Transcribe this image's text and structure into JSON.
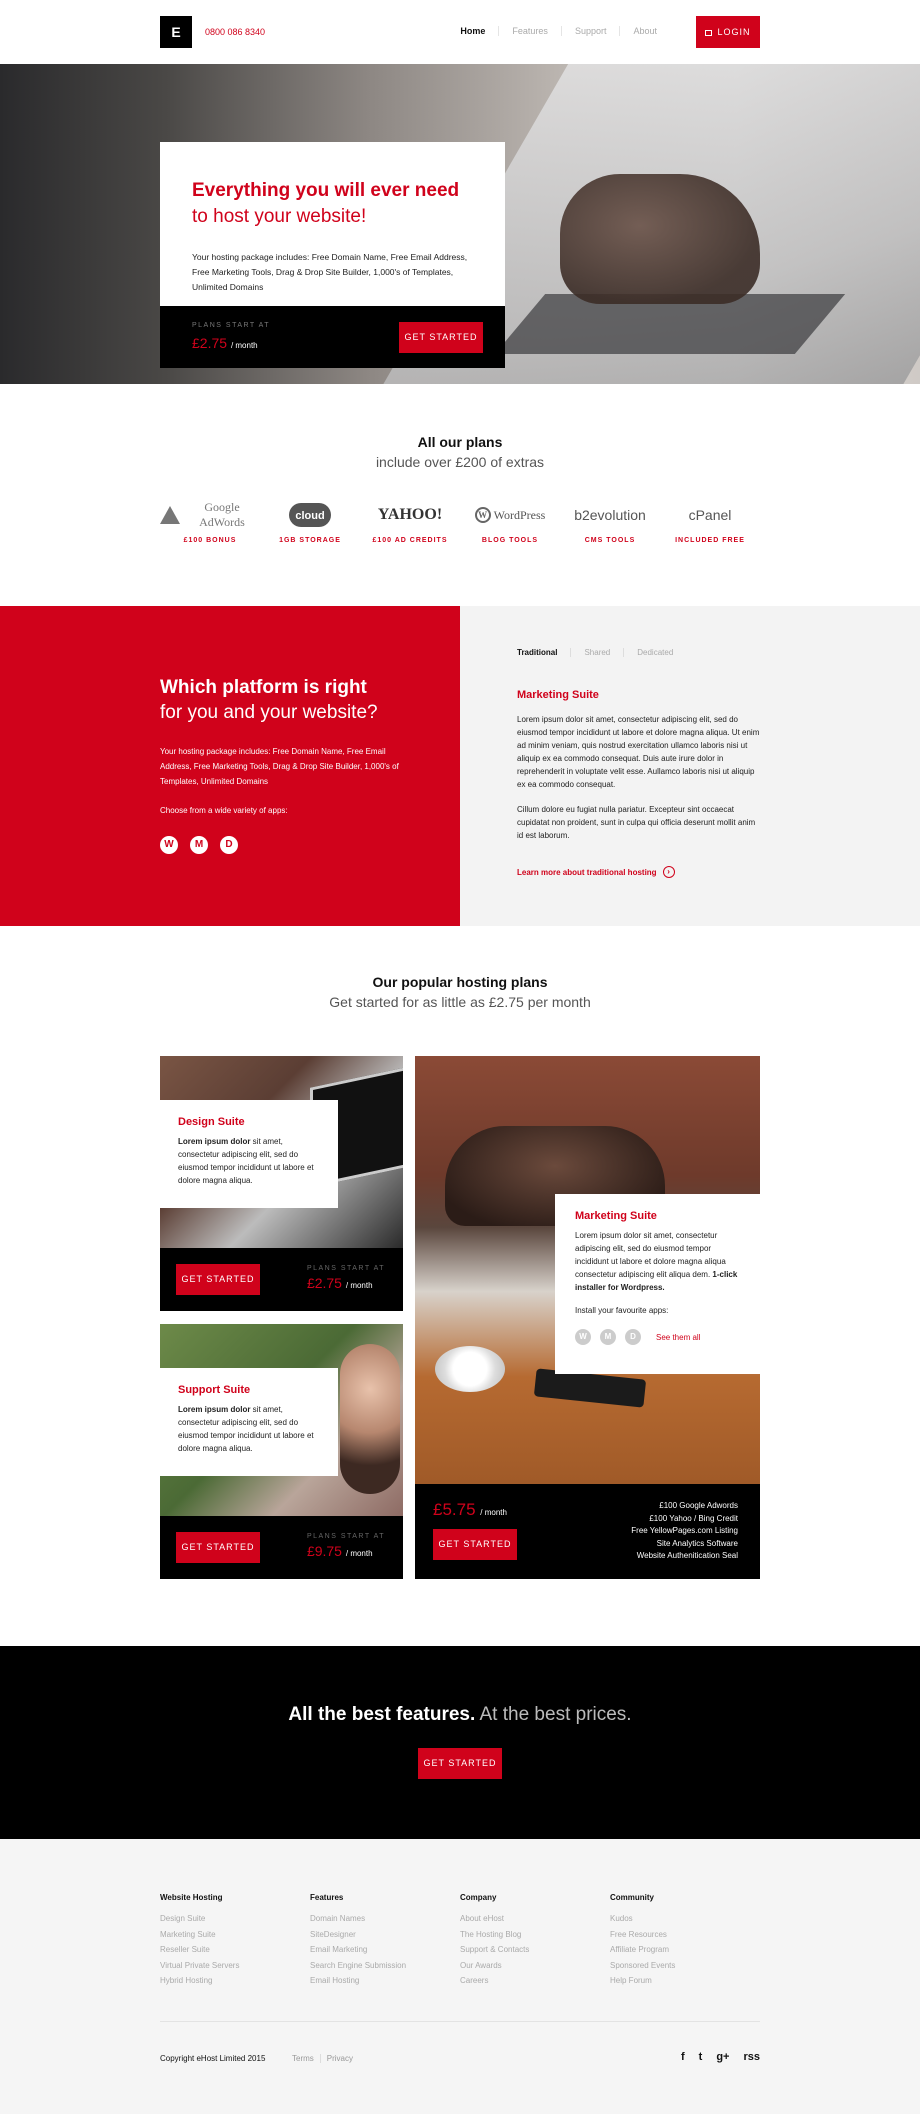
{
  "header": {
    "logo": "E",
    "phone": "0800 086 8340",
    "nav": [
      "Home",
      "Features",
      "Support",
      "About"
    ],
    "login": "LOGIN"
  },
  "hero": {
    "title": "Everything you will ever need",
    "subtitle": "to host your website!",
    "body": "Your hosting package includes: Free Domain Name, Free Email Address, Free Marketing Tools, Drag & Drop Site Builder, 1,000's of Templates, Unlimited Domains",
    "plans_label": "PLANS START AT",
    "price": "£2.75",
    "price_unit": "/ month",
    "cta": "GET STARTED"
  },
  "plans": {
    "title": "All our plans",
    "subtitle": "include over £200 of extras",
    "brands": [
      {
        "logo": "Google AdWords",
        "caption": "£100 BONUS"
      },
      {
        "logo": "cloud",
        "caption": "1GB STORAGE"
      },
      {
        "logo": "YAHOO!",
        "caption": "£100 AD CREDITS"
      },
      {
        "logo": "WordPress",
        "caption": "BLOG TOOLS"
      },
      {
        "logo": "b2evolution",
        "caption": "CMS TOOLS"
      },
      {
        "logo": "cPanel",
        "caption": "INCLUDED FREE"
      }
    ]
  },
  "platform": {
    "title": "Which platform is right",
    "subtitle": "for you and your website?",
    "body": "Your hosting package includes: Free Domain Name, Free Email Address, Free Marketing Tools, Drag & Drop Site Builder, 1,000's of Templates, Unlimited Domains",
    "choose": "Choose from a wide variety of apps:",
    "tabs": [
      "Traditional",
      "Shared",
      "Dedicated"
    ],
    "panel_title": "Marketing Suite",
    "panel_p1": "Lorem ipsum dolor sit amet, consectetur adipiscing elit, sed do eiusmod tempor incididunt ut labore et dolore magna aliqua. Ut enim ad minim veniam, quis nostrud exercitation ullamco laboris nisi ut aliquip ex ea commodo consequat. Duis aute irure dolor in reprehenderit in voluptate velit esse. Aullamco laboris nisi ut aliquip ex ea commodo consequat.",
    "panel_p2": "Cillum dolore eu fugiat nulla pariatur. Excepteur sint occaecat cupidatat non proident, sunt in culpa qui officia deserunt mollit anim id est laborum.",
    "learn_more": "Learn more about traditional hosting"
  },
  "popular": {
    "title": "Our popular hosting plans",
    "subtitle": "Get started for as little as £2.75 per month",
    "design": {
      "title": "Design Suite",
      "lead": "Lorem ipsum dolor",
      "body": " sit amet, consectetur adipiscing elit, sed do eiusmod tempor incididunt ut labore et dolore magna aliqua.",
      "cta": "GET STARTED",
      "plans_label": "PLANS START AT",
      "price": "£2.75",
      "price_unit": "/ month"
    },
    "support": {
      "title": "Support Suite",
      "lead": "Lorem ipsum dolor",
      "body": " sit amet, consectetur adipiscing elit, sed do eiusmod tempor incididunt ut labore et dolore magna aliqua.",
      "cta": "GET STARTED",
      "plans_label": "PLANS START AT",
      "price": "£9.75",
      "price_unit": "/ month"
    },
    "marketing": {
      "title": "Marketing Suite",
      "body": "Lorem ipsum dolor sit amet, consectetur adipiscing elit, sed do eiusmod tempor incididunt ut labore et dolore magna aliqua consectetur adipiscing elit aliqua dem.",
      "bold": "1-click installer for Wordpress.",
      "install": "Install your favourite apps:",
      "see_all": "See them all",
      "price": "£5.75",
      "price_unit": "/ month",
      "cta": "GET STARTED",
      "features": [
        "£100 Google Adwords",
        "£100 Yahoo / Bing Credit",
        "Free YellowPages.com Listing",
        "Site Analytics Software",
        "Website Authenitication Seal"
      ]
    }
  },
  "cta": {
    "bold": "All the best features.",
    "light": " At the best prices.",
    "button": "GET STARTED"
  },
  "footer": {
    "columns": [
      {
        "head": "Website Hosting",
        "links": [
          "Design Suite",
          "Marketing Suite",
          "Reseller Suite",
          "Virtual Private Servers",
          "Hybrid Hosting"
        ]
      },
      {
        "head": "Features",
        "links": [
          "Domain Names",
          "SiteDesigner",
          "Email Marketing",
          "Search Engine Submission",
          "Email Hosting"
        ]
      },
      {
        "head": "Company",
        "links": [
          "About eHost",
          "The Hosting Blog",
          "Support & Contacts",
          "Our Awards",
          "Careers"
        ]
      },
      {
        "head": "Community",
        "links": [
          "Kudos",
          "Free Resources",
          "Affiliate Program",
          "Sponsored Events",
          "Help Forum"
        ]
      }
    ],
    "copyright": "Copyright eHost Limited 2015",
    "legal": [
      "Terms",
      "Privacy"
    ],
    "social_icons": [
      "facebook-icon",
      "twitter-icon",
      "google-plus-icon",
      "rss-icon"
    ],
    "social_glyphs": [
      "f",
      "t",
      "g+",
      "rss"
    ]
  },
  "colors": {
    "brand_red": "#d0021b",
    "black": "#000000",
    "light_gray": "#f3f3f3"
  }
}
